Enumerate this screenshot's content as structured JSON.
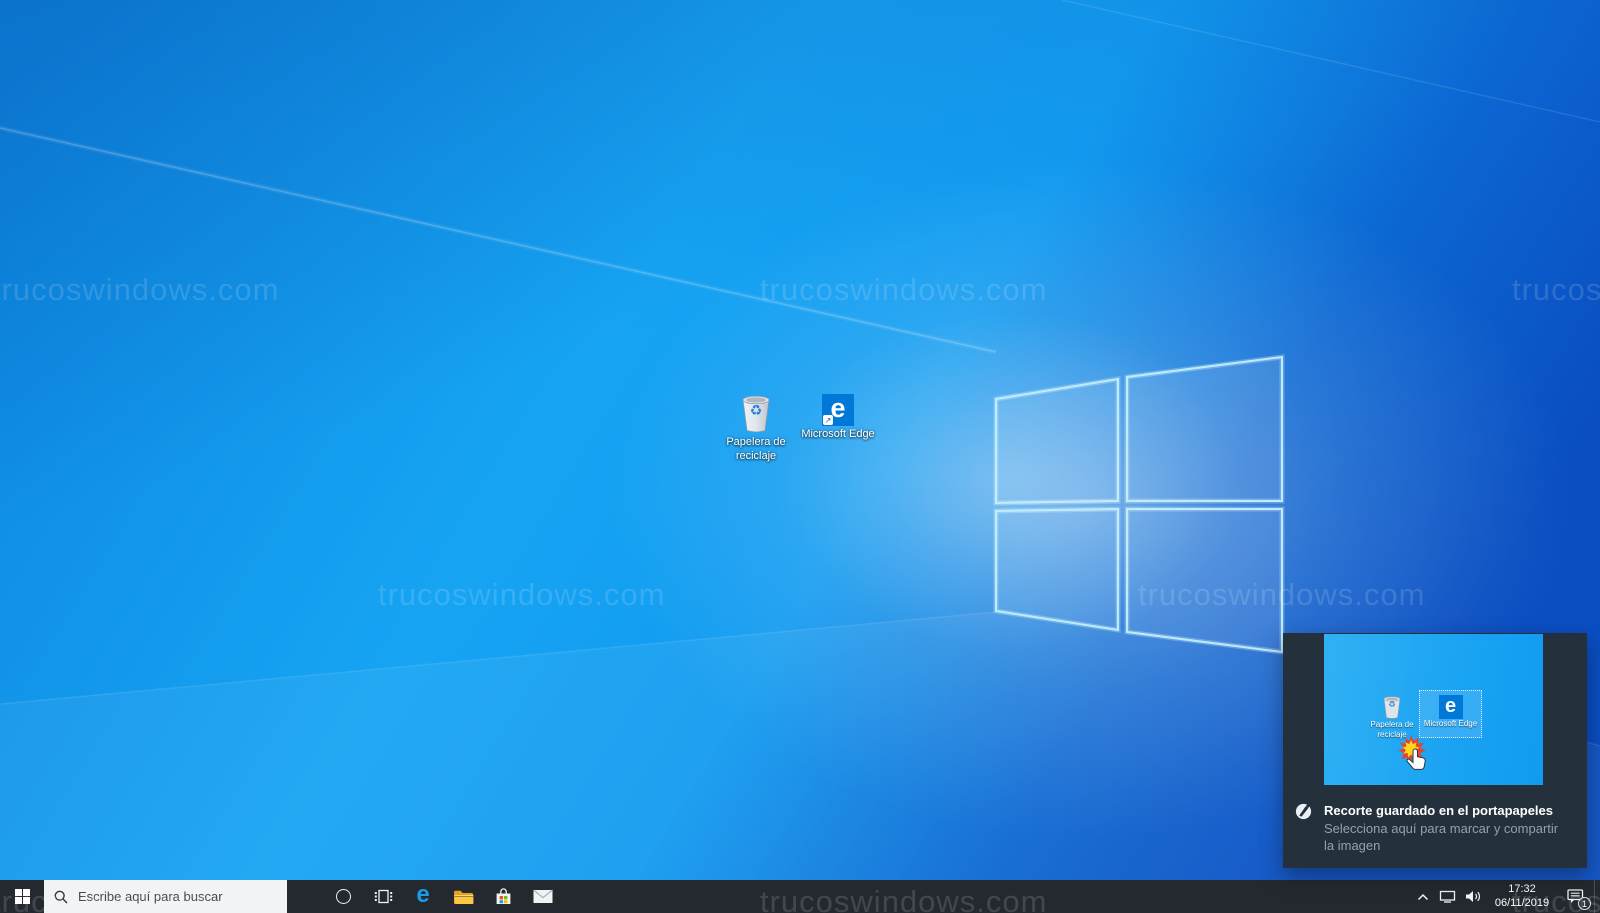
{
  "wallpaper": {
    "watermark_text": "trucoswindows.com"
  },
  "icons": {
    "recycle_glyph": "♻",
    "shortcut_arrow": "↗",
    "edge_letter": "e"
  },
  "desktop_icons": {
    "recycle_bin": {
      "label_line1": "Papelera de",
      "label_line2": "reciclaje"
    },
    "edge": {
      "label": "Microsoft Edge"
    }
  },
  "toast": {
    "title": "Recorte guardado en el portapapeles",
    "subtitle_line1": "Selecciona aquí para marcar y compartir",
    "subtitle_line2": "la imagen",
    "thumbnail": {
      "recycle_bin_label_line1": "Papelera de",
      "recycle_bin_label_line2": "reciclaje",
      "edge_label": "Microsoft Edge"
    }
  },
  "taskbar": {
    "search": {
      "placeholder": "Escribe aquí para buscar"
    },
    "tray": {
      "time": "17:32",
      "date": "06/11/2019",
      "notification_count": "1"
    }
  },
  "colors": {
    "accent_blue": "#0078d7",
    "wallpaper_light": "#18a6f4",
    "wallpaper_royal": "#0a4ec2",
    "taskbar_bg": "#242930",
    "toast_bg": "#25303d"
  }
}
